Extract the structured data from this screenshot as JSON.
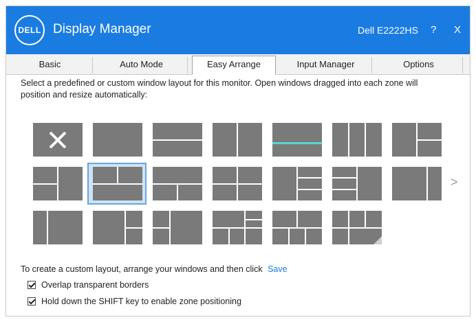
{
  "app": {
    "logo": "DELL",
    "title": "Display Manager",
    "monitor": "Dell E2222HS",
    "help": "?",
    "close": "X"
  },
  "tabs": [
    {
      "label": "Basic"
    },
    {
      "label": "Auto Mode"
    },
    {
      "label": "Easy Arrange"
    },
    {
      "label": "Input Manager"
    },
    {
      "label": "Options"
    }
  ],
  "description": "Select a predefined or custom window layout for this monitor.  Open windows dragged into each zone will position and resize automatically:",
  "next_arrow": ">",
  "custom": {
    "text": "To create a custom layout, arrange your windows and then click",
    "save": "Save"
  },
  "options": [
    {
      "label": "Overlap transparent borders",
      "checked": true
    },
    {
      "label": "Hold down the SHIFT key to enable zone positioning",
      "checked": true
    }
  ],
  "colors": {
    "accent": "#1a7ce0",
    "zone": "#7a7a7a",
    "selected": "#cfe3f4"
  }
}
